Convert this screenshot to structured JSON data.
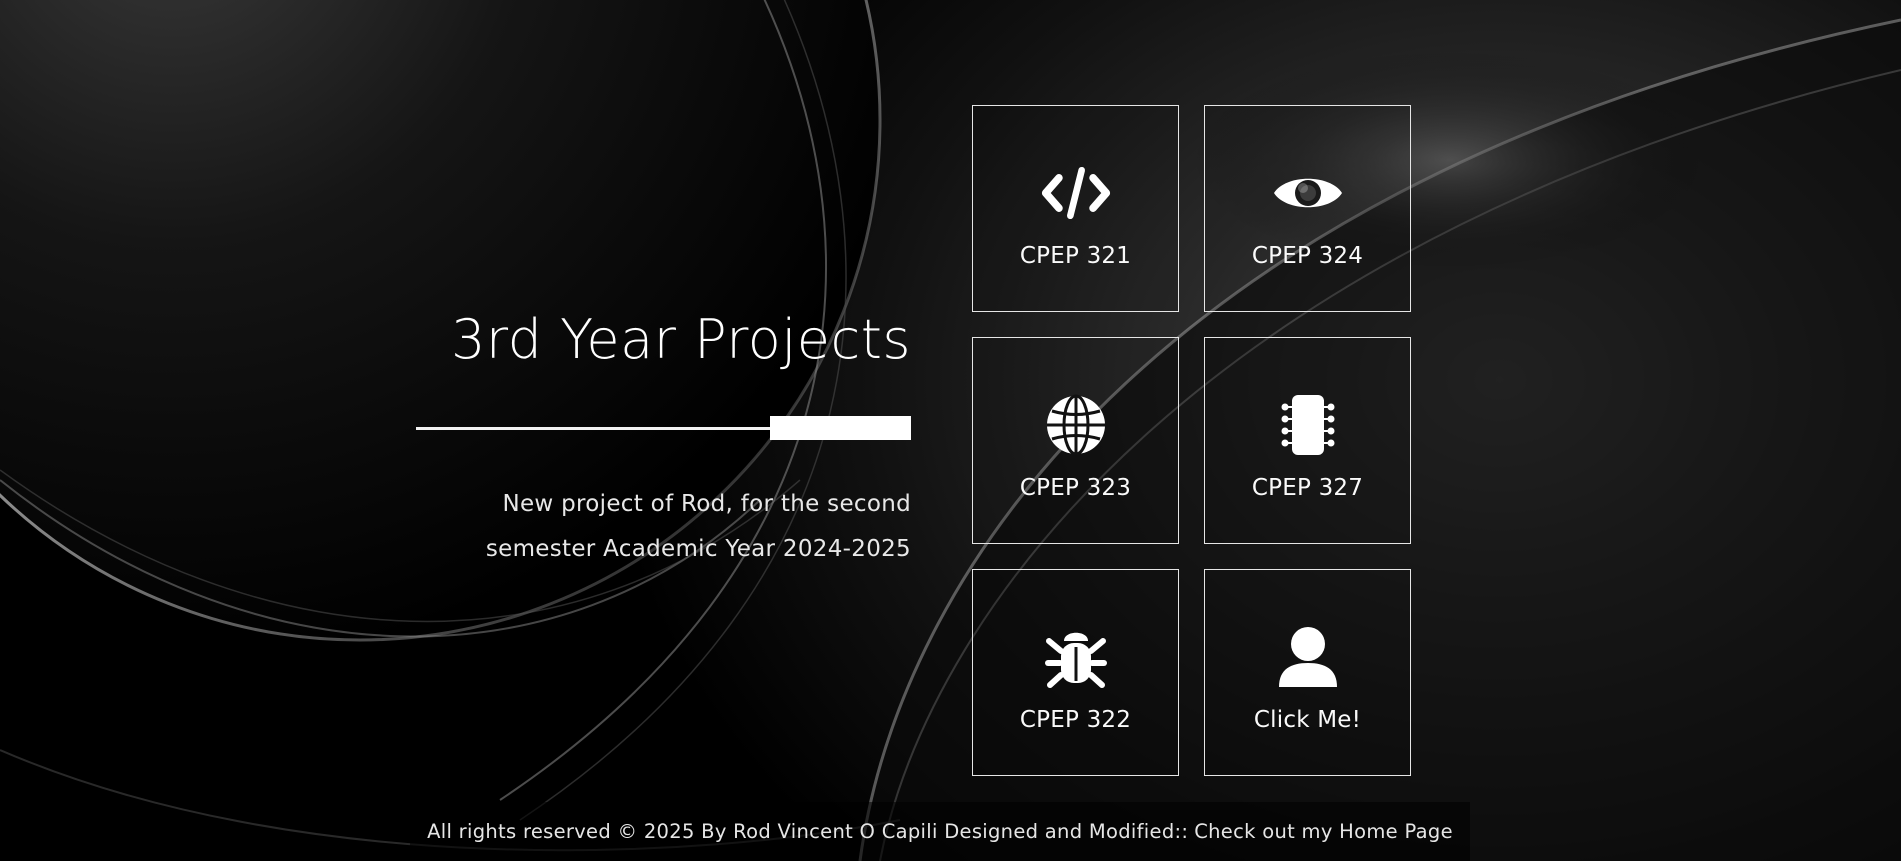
{
  "hero": {
    "title": "3rd Year Projects",
    "subtitle": "New project of Rod, for the second semester Academic Year 2024-2025"
  },
  "tiles": [
    {
      "label": "CPEP 321",
      "icon": "code-icon"
    },
    {
      "label": "CPEP 324",
      "icon": "eye-icon"
    },
    {
      "label": "CPEP 323",
      "icon": "globe-icon"
    },
    {
      "label": "CPEP 327",
      "icon": "chip-icon"
    },
    {
      "label": "CPEP 322",
      "icon": "bug-icon"
    },
    {
      "label": "Click Me!",
      "icon": "user-icon"
    }
  ],
  "footer": {
    "text": "All rights reserved © 2025 By Rod Vincent O Capili Designed and Modified::",
    "link": "Check out my Home Page"
  },
  "colors": {
    "text": "#ffffff",
    "background": "#000000",
    "tile_border": "#e6e6e6"
  }
}
